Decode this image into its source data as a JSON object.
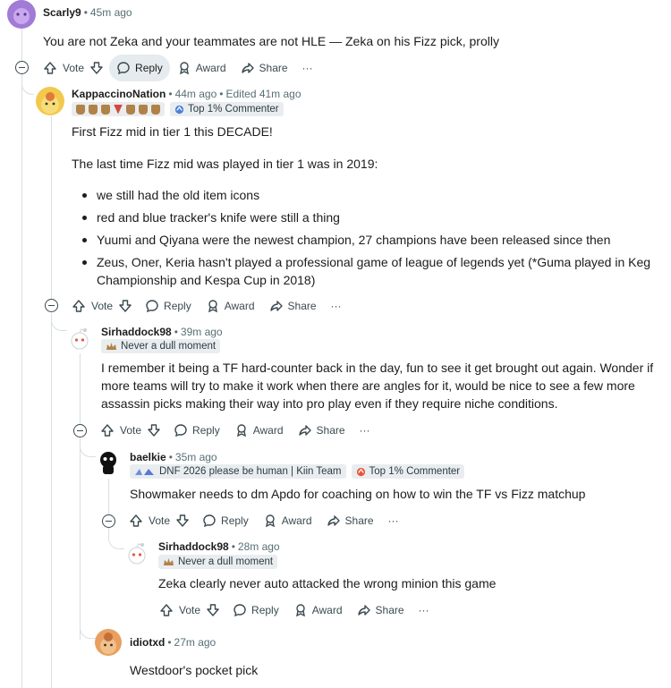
{
  "actions": {
    "vote": "Vote",
    "reply": "Reply",
    "award": "Award",
    "share": "Share",
    "more": "···"
  },
  "comments": {
    "c0": {
      "user": "Scarly9",
      "time": "45m ago",
      "body": "You are not Zeka and your teammates are not HLE — Zeka on his Fizz pick, prolly"
    },
    "c1": {
      "user": "KappaccinoNation",
      "time": "44m ago",
      "edited": "Edited 41m ago",
      "flair": "Top 1% Commenter",
      "p1": "First Fizz mid in tier 1 this DECADE!",
      "p2": "The last time Fizz mid was played in tier 1 was in 2019:",
      "bullets": [
        "we still had the old item icons",
        "red and blue tracker's knife were still a thing",
        "Yuumi and Qiyana were the newest champion, 27 champions have been released since then",
        "Zeus, Oner, Keria hasn't played a professional game of league of legends yet (*Guma played in Keg Championship and Kespa Cup in 2018)"
      ]
    },
    "c2": {
      "user": "Sirhaddock98",
      "time": "39m ago",
      "flair": "Never a dull moment",
      "body": "I remember it being a TF hard-counter back in the day, fun to see it get brought out again. Wonder if more teams will try to make it work when there are angles for it, would be nice to see a few more assassin picks making their way into pro play even if they require niche conditions."
    },
    "c3": {
      "user": "baelkie",
      "time": "35m ago",
      "flair1": "DNF 2026 please be human | Kiin Team",
      "flair2": "Top 1% Commenter",
      "body": "Showmaker needs to dm Apdo for coaching on how to win the TF vs Fizz matchup"
    },
    "c4": {
      "user": "Sirhaddock98",
      "time": "28m ago",
      "flair": "Never a dull moment",
      "body": "Zeka clearly never auto attacked the wrong minion this game"
    },
    "c5": {
      "user": "idiotxd",
      "time": "27m ago",
      "body": "Westdoor's pocket pick"
    }
  },
  "colors": {
    "accent_purple": "#a27bd6",
    "avatar_yellow": "#f2c94c",
    "avatar_orange": "#e8a060",
    "meta": "#576f76",
    "highlight": "#e5ebee"
  }
}
